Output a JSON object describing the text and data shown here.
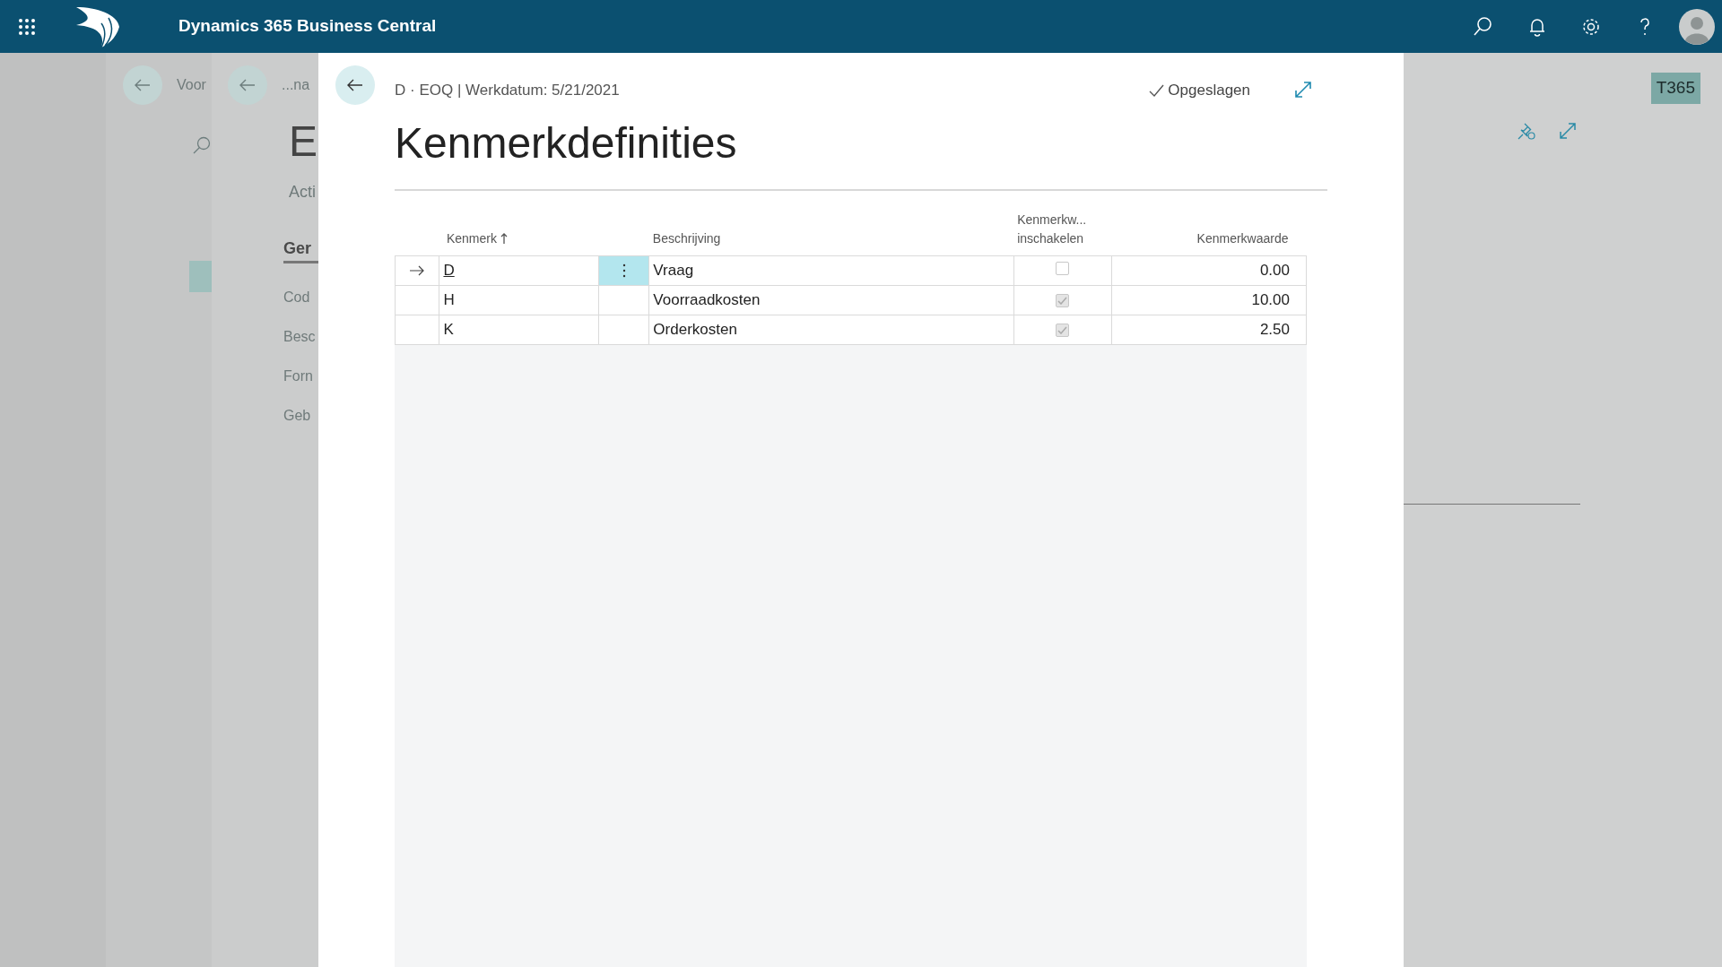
{
  "app_bar": {
    "title": "Dynamics 365 Business Central"
  },
  "background_page_1": {
    "breadcrumb": "Voor"
  },
  "background_page_2": {
    "breadcrumb": "...na",
    "title": "E",
    "actions": "Acti",
    "section": "Ger",
    "fields": [
      "Cod",
      "Besc",
      "Forn",
      "Geb"
    ]
  },
  "right_page": {
    "badge": "T365"
  },
  "dialog": {
    "breadcrumb": "D · EOQ | Werkdatum: 5/21/2021",
    "status": "Opgeslagen",
    "title": "Kenmerkdefinities",
    "columns": [
      {
        "label": "Kenmerk",
        "sort_ascending": true
      },
      {
        "label": "Beschrijving",
        "sort_ascending": false
      },
      {
        "label": "Kenmerkw... inschakelen",
        "sort_ascending": false
      },
      {
        "label": "Kenmerkwaarde",
        "sort_ascending": false
      }
    ],
    "rows": [
      {
        "selected": true,
        "kenmerk": "D",
        "beschrijving": "Vraag",
        "checked": false,
        "waarde": "0.00"
      },
      {
        "selected": false,
        "kenmerk": "H",
        "beschrijving": "Voorraadkosten",
        "checked": true,
        "waarde": "10.00"
      },
      {
        "selected": false,
        "kenmerk": "K",
        "beschrijving": "Orderkosten",
        "checked": true,
        "waarde": "2.50"
      }
    ]
  }
}
